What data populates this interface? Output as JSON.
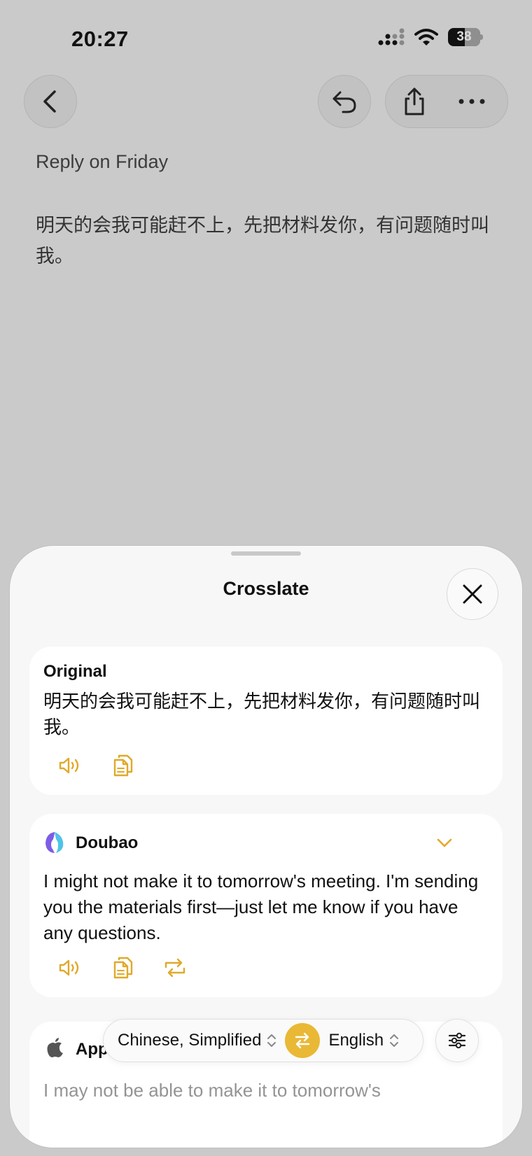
{
  "status": {
    "time": "20:27",
    "battery": "38"
  },
  "note": {
    "title": "Reply on Friday",
    "body": "明天的会我可能赶不上，先把材料发你，有问题随时叫我。"
  },
  "sheet": {
    "title": "Crosslate",
    "original": {
      "label": "Original",
      "text": "明天的会我可能赶不上，先把材料发你，有问题随时叫我。"
    },
    "results": [
      {
        "provider": "Doubao",
        "text": "I might not make it to tomorrow's meeting. I'm sending you the materials first—just let me know if you have any questions."
      },
      {
        "provider": "Apple Translate",
        "text": "I may not be able to make it to tomorrow's"
      }
    ],
    "source_lang": "Chinese, Simplified",
    "target_lang": "English"
  },
  "colors": {
    "accent": "#e9b835",
    "background": "#cacaca",
    "sheet": "#f7f7f7"
  }
}
